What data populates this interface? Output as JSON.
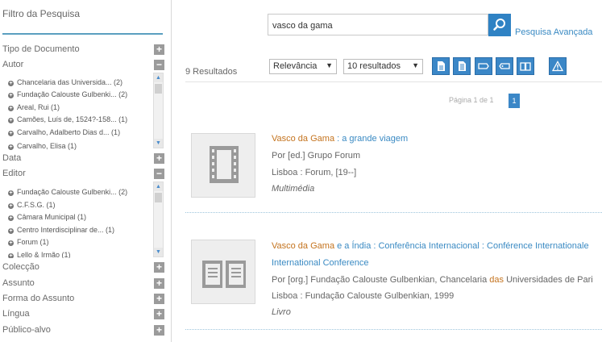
{
  "sidebar": {
    "title": "Filtro da Pesquisa",
    "facets": [
      {
        "label": "Tipo de Documento",
        "toggle": "+"
      },
      {
        "label": "Autor",
        "toggle": "−",
        "items": [
          "Chancelaria das Universida... (2)",
          "Fundação Calouste Gulbenki... (2)",
          "Areal, Rui (1)",
          "Camões, Luís de, 1524?-158... (1)",
          "Carvalho, Adalberto Dias d... (1)",
          "Carvalho, Elisa (1)"
        ]
      },
      {
        "label": "Data",
        "toggle": "+"
      },
      {
        "label": "Editor",
        "toggle": "−",
        "items": [
          "Fundação Calouste Gulbenki... (2)",
          "C.F.S.G. (1)",
          "Câmara Municipal (1)",
          "Centro Interdisciplinar de... (1)",
          "Forum (1)",
          "Lello & Irmão (1)"
        ]
      },
      {
        "label": "Colecção",
        "toggle": "+"
      },
      {
        "label": "Assunto",
        "toggle": "+"
      },
      {
        "label": "Forma do Assunto",
        "toggle": "+"
      },
      {
        "label": "Língua",
        "toggle": "+"
      },
      {
        "label": "Público-alvo",
        "toggle": "+"
      }
    ]
  },
  "search": {
    "value": "vasco da gama",
    "advanced_label": "Pesquisa Avançada"
  },
  "toolbar": {
    "results_count": "9 Resultados",
    "sort_value": "Relevância",
    "per_page_value": "10 resultados"
  },
  "pagination": {
    "info": "Página 1 de 1",
    "current": "1"
  },
  "results": [
    {
      "title_highlight": "Vasco da Gama",
      "title_rest": " : a grande viagem",
      "author_prefix": "Por [ed.] ",
      "author": "Grupo Forum",
      "publisher": "Lisboa : Forum, [19--]",
      "type": "Multimédia",
      "icon": "film-icon"
    },
    {
      "title_highlight": "Vasco da Gama",
      "title_mid": " e a Índia : Conferência Internacional : Conférence Internationale",
      "title_line2": "International Conference",
      "author_prefix": "Por [org.] ",
      "author_a": "Fundação Calouste Gulbenkian, Chancelaria ",
      "author_hl": "das",
      "author_b": " Universidades de Pari",
      "publisher": "Lisboa : Fundação Calouste Gulbenkian, 1999",
      "type": "Livro",
      "icon": "book-icon"
    }
  ],
  "colors": {
    "accent": "#3b87c7",
    "highlight": "#c4731e",
    "link": "#3a8ac3"
  }
}
